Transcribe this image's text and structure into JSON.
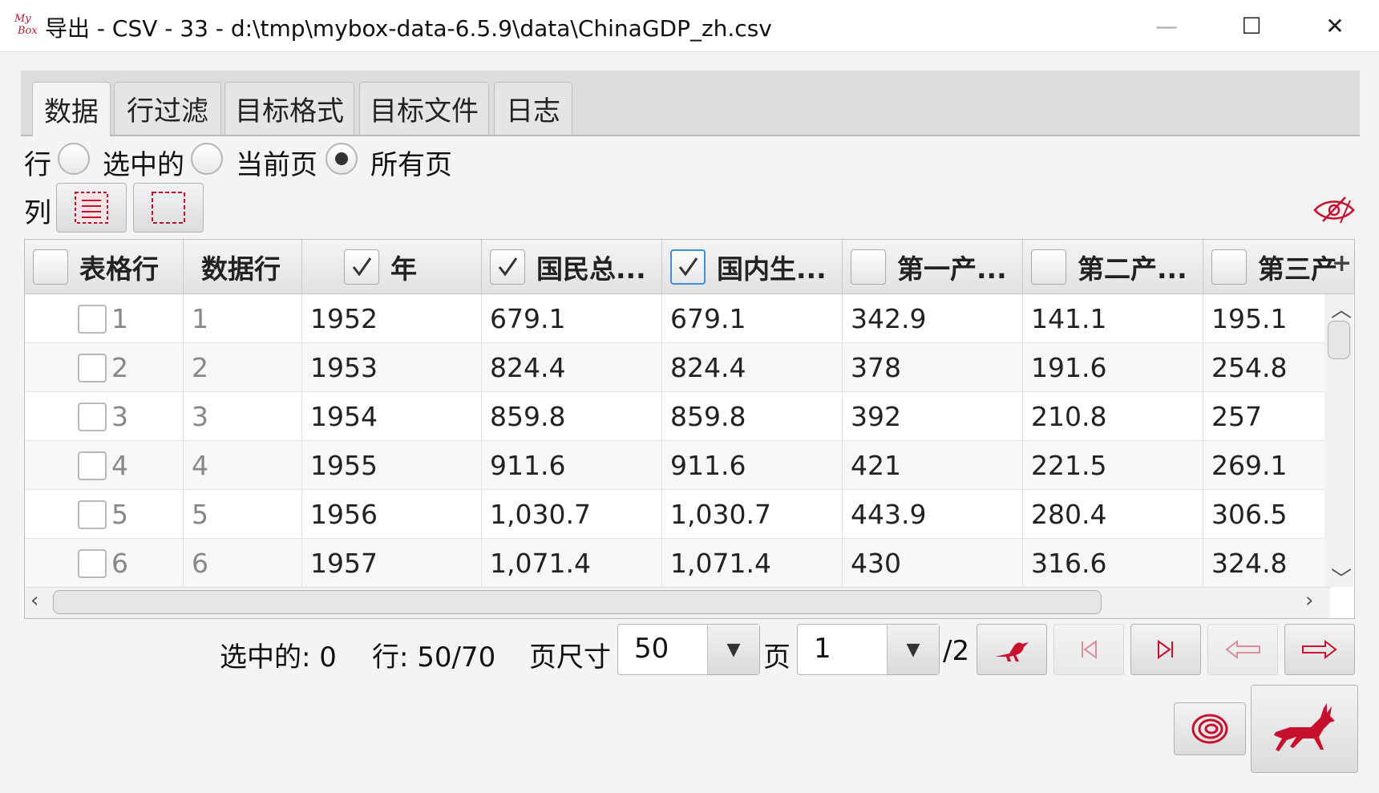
{
  "window": {
    "title": "导出 - CSV - 33 - d:\\tmp\\mybox-data-6.5.9\\data\\ChinaGDP_zh.csv",
    "logo_line1": "My",
    "logo_line2": "Box",
    "controls": {
      "minimize": "—",
      "maximize": "☐",
      "close": "✕"
    }
  },
  "tabs": [
    {
      "label": "数据",
      "active": true
    },
    {
      "label": "行过滤",
      "active": false
    },
    {
      "label": "目标格式",
      "active": false
    },
    {
      "label": "目标文件",
      "active": false
    },
    {
      "label": "日志",
      "active": false
    }
  ],
  "rows_option": {
    "label": "行",
    "options": [
      {
        "label": "选中的",
        "selected": false
      },
      {
        "label": "当前页",
        "selected": false
      },
      {
        "label": "所有页",
        "selected": true
      }
    ]
  },
  "columns_option": {
    "label": "列",
    "select_all_icon": "select-all-icon",
    "select_none_icon": "select-none-icon",
    "view_icon": "eye-icon"
  },
  "table": {
    "headers": [
      {
        "label": "表格行",
        "checkbox": true,
        "checked": false
      },
      {
        "label": "数据行",
        "checkbox": false
      },
      {
        "label": "年",
        "checkbox": true,
        "checked": true
      },
      {
        "label": "国民总...",
        "checkbox": true,
        "checked": true
      },
      {
        "label": "国内生...",
        "checkbox": true,
        "checked": true,
        "focused": true
      },
      {
        "label": "第一产...",
        "checkbox": true,
        "checked": false
      },
      {
        "label": "第二产...",
        "checkbox": true,
        "checked": false
      },
      {
        "label": "第三产",
        "checkbox": true,
        "checked": false
      }
    ],
    "add_column_icon": "+",
    "rows": [
      [
        "1",
        "1",
        "1952",
        "679.1",
        "679.1",
        "342.9",
        "141.1",
        "195.1"
      ],
      [
        "2",
        "2",
        "1953",
        "824.4",
        "824.4",
        "378",
        "191.6",
        "254.8"
      ],
      [
        "3",
        "3",
        "1954",
        "859.8",
        "859.8",
        "392",
        "210.8",
        "257"
      ],
      [
        "4",
        "4",
        "1955",
        "911.6",
        "911.6",
        "421",
        "221.5",
        "269.1"
      ],
      [
        "5",
        "5",
        "1956",
        "1,030.7",
        "1,030.7",
        "443.9",
        "280.4",
        "306.5"
      ],
      [
        "6",
        "6",
        "1957",
        "1,071.4",
        "1,071.4",
        "430",
        "316.6",
        "324.8"
      ]
    ]
  },
  "footer": {
    "selected_text": "选中的: 0",
    "rows_text": "行: 50/70",
    "page_size_label": "页尺寸",
    "page_size_value": "50",
    "page_label": "页",
    "page_value": "1",
    "page_total": "/2"
  },
  "colors": {
    "accent": "#c8102e",
    "focus": "#3d8fd9"
  }
}
